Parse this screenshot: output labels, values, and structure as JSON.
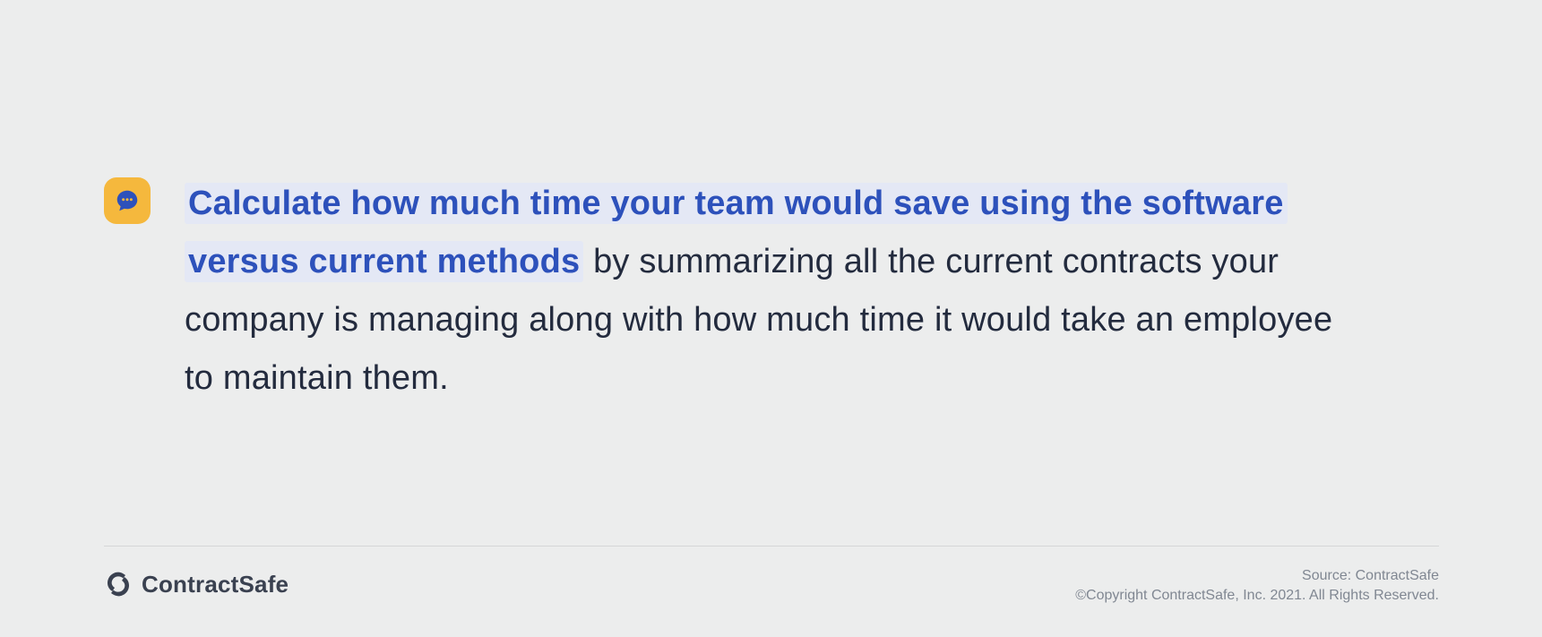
{
  "tip": {
    "highlight": "Calculate how much time your team would save using the software versus current methods",
    "rest": " by summarizing all the current contracts your company is managing along with how much time it would take an employee to maintain them."
  },
  "logo": {
    "name": "ContractSafe"
  },
  "credits": {
    "source": "Source: ContractSafe",
    "copyright": "©Copyright ContractSafe, Inc. 2021. All Rights Reserved."
  }
}
